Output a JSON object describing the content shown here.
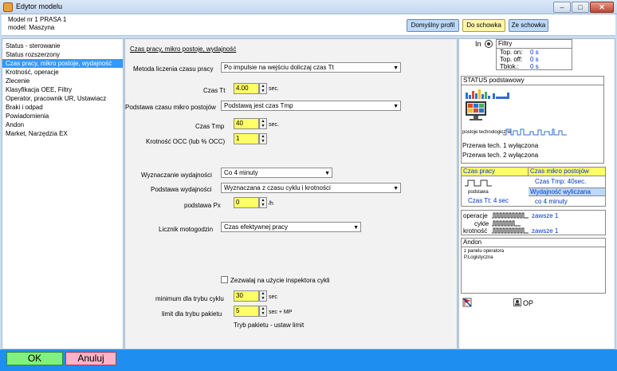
{
  "window": {
    "title": "Edytor modelu"
  },
  "header": {
    "model_line1": "Model nr 1  PRASA 1",
    "model_line2": "model: Maszyna",
    "default_profile_btn": "Domyślny profil",
    "to_clipboard_btn": "Do schowka",
    "from_clipboard_btn": "Ze schowka"
  },
  "sidebar": {
    "items": [
      "Status - sterowanie",
      "Status rozszerzony",
      "Czas pracy, mikro postoje, wydajność",
      "Krotność, operacje",
      "Zlecenie",
      "Klasyfikacja OEE, Filtry",
      "Operator, pracownik UR, Ustawiacz",
      "Braki i odpad",
      "Powiadomienia",
      "Andon",
      "Market, Narzędzia EX"
    ],
    "selected_index": 2
  },
  "main": {
    "section_title": "Czas pracy, mikro postoje, wydajność",
    "method_label": "Metoda liczenia czasu pracy",
    "method_value": "Po impulsie na wejściu doliczaj czas Tt",
    "tt_label": "Czas Tt",
    "tt_value": "4.00",
    "tt_unit": "sec.",
    "micro_base_label": "Podstawa czasu mikro postojów",
    "micro_base_value": "Podstawą jest czas Tmp",
    "tmp_label": "Czas Tmp",
    "tmp_value": "40",
    "tmp_unit": "sec.",
    "occ_label": "Krotność OCC (lub % OCC)",
    "occ_value": "1",
    "perf_calc_label": "Wyznaczanie  wydajności",
    "perf_calc_value": "Co 4 minuty",
    "perf_base_label": "Podstawa wydajności",
    "perf_base_value": "Wyznaczana z czasu cyklu i krotności",
    "px_label": "podstawa Px",
    "px_value": "0",
    "px_unit": "/h",
    "counter_label": "Licznik motogodzin",
    "counter_value": "Czas efektywnej pracy",
    "inspector_label": "Zezwalaj na użycie inspektora cykli",
    "min_cycle_label": "minimum dla trybu cyklu",
    "min_cycle_value": "30",
    "min_cycle_unit": "sec",
    "packet_limit_label": "limit  dla trybu pakietu",
    "packet_limit_value": "5",
    "packet_limit_unit": "sec + MP",
    "packet_mode_text": "Tryb pakietu - ustaw limit"
  },
  "right": {
    "in_label": "In",
    "filters": {
      "title": "Filtry",
      "top_on_label": "Top. on:",
      "top_on_value": "0 s",
      "top_off_label": "Top. off:",
      "top_off_value": "0 s",
      "tblok_label": "Tblok.:",
      "tblok_value": "0 s"
    },
    "status_title": "STATUS podstawowy",
    "tech_stops_label": "postoje technologiczne",
    "break1": "Przerwa tech. 1 wyłączona",
    "break2": "Przerwa tech. 2 wyłączona",
    "worktime_title": "Czas pracy",
    "base_label": "podstawa",
    "tt_text": "Czas Tt: 4 sec",
    "micro_title": "Czas mikro postojów",
    "tmp_text": "Czas Tmp: 40sec.",
    "perf_title": "Wydajność wyliczana",
    "perf_text": "co 4 minuty",
    "ops_label": "operacje",
    "ops_value": "zawsze 1",
    "cycle_label": "cykle",
    "krot_label": "krotność",
    "krot_value": "zawsze 1",
    "andon_title": "Andon",
    "andon_line1": "z panelu operatora",
    "andon_line2": "P.Logistyczna",
    "op_label": "OP"
  },
  "footer": {
    "ok": "OK",
    "cancel": "Anuluj"
  }
}
